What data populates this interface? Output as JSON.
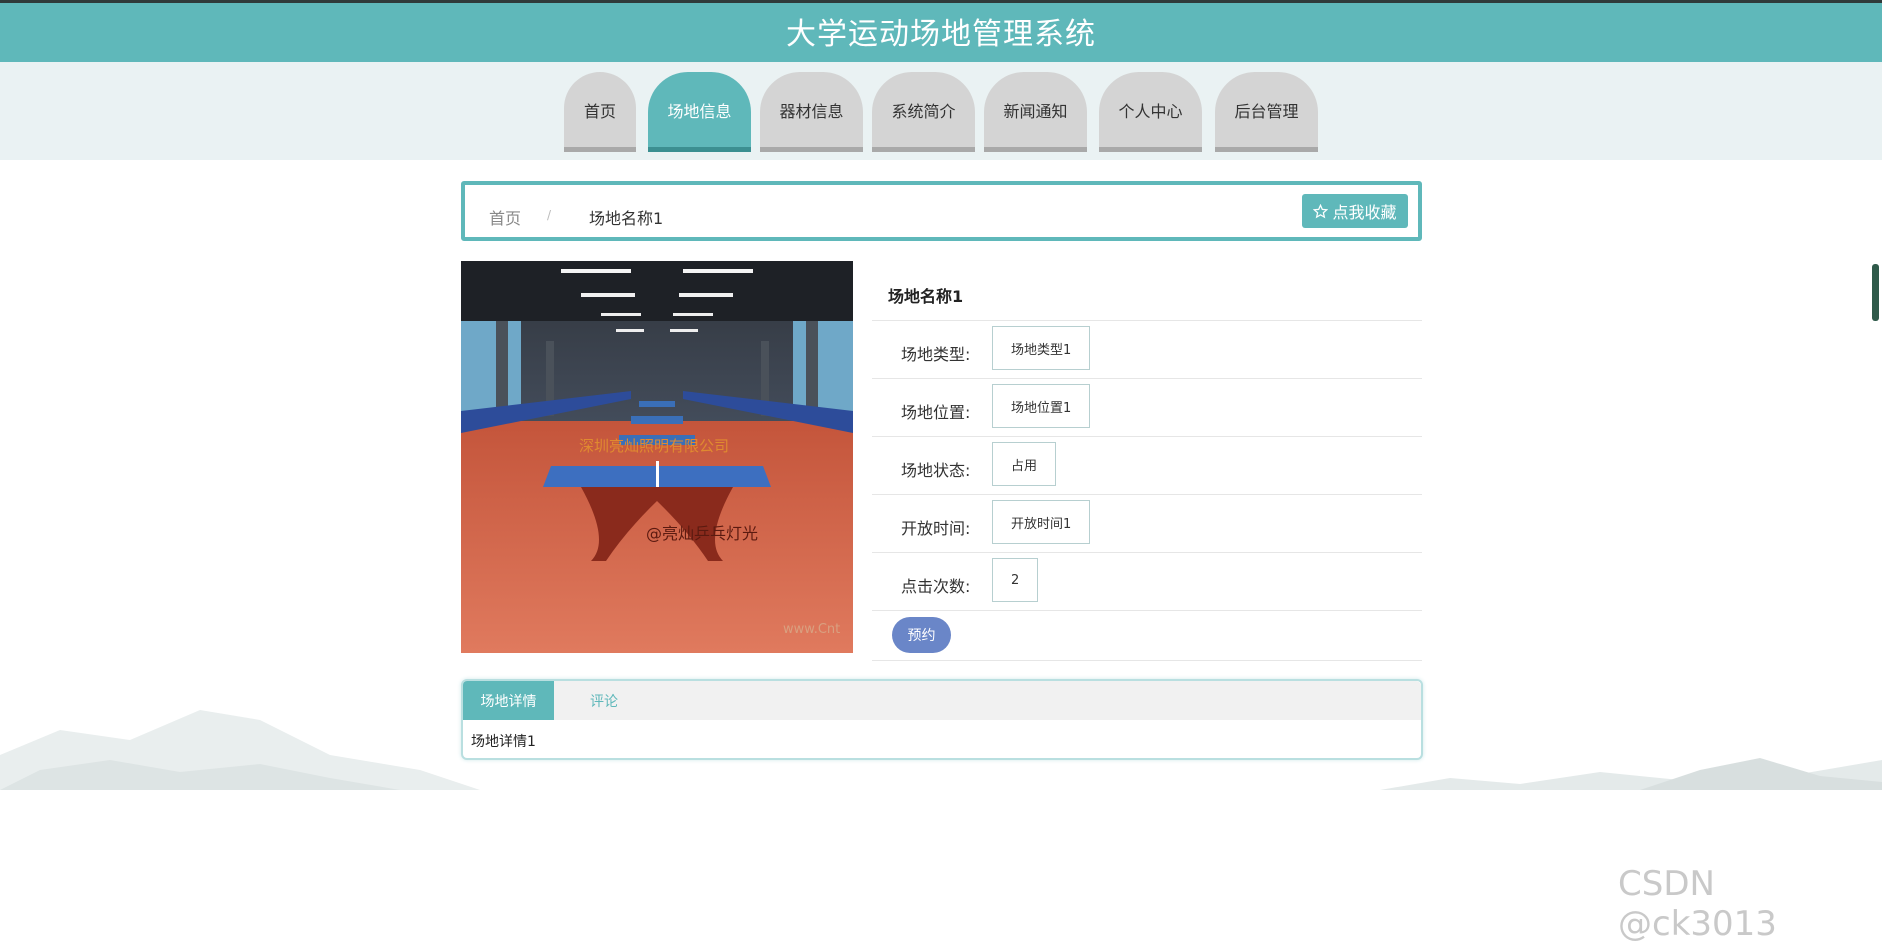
{
  "header": {
    "title": "大学运动场地管理系统"
  },
  "nav": {
    "tabs": [
      {
        "label": "首页"
      },
      {
        "label": "场地信息"
      },
      {
        "label": "器材信息"
      },
      {
        "label": "系统简介"
      },
      {
        "label": "新闻通知"
      },
      {
        "label": "个人中心"
      },
      {
        "label": "后台管理"
      }
    ],
    "active_index": 1
  },
  "breadcrumb": {
    "home": "首页",
    "separator": "/",
    "current": "场地名称1",
    "favorite_label": "点我收藏",
    "favorite_icon": "star-outline-icon"
  },
  "photo": {
    "text_top": "深圳亮灿照明有限公司",
    "text_bottom": "@亮灿乒乓灯光",
    "text_corner": "www.Cnt"
  },
  "venue": {
    "name": "场地名称1",
    "fields": [
      {
        "label": "场地类型:",
        "value": "场地类型1"
      },
      {
        "label": "场地位置:",
        "value": "场地位置1"
      },
      {
        "label": "场地状态:",
        "value": "占用"
      },
      {
        "label": "开放时间:",
        "value": "开放时间1"
      },
      {
        "label": "点击次数:",
        "value": "2"
      }
    ],
    "book_label": "预约"
  },
  "detail": {
    "tabs": [
      {
        "label": "场地详情"
      },
      {
        "label": "评论"
      }
    ],
    "content": "场地详情1"
  },
  "watermark": "CSDN @ck3013",
  "colors": {
    "accent": "#5fb8ba",
    "book": "#6a86c8"
  }
}
